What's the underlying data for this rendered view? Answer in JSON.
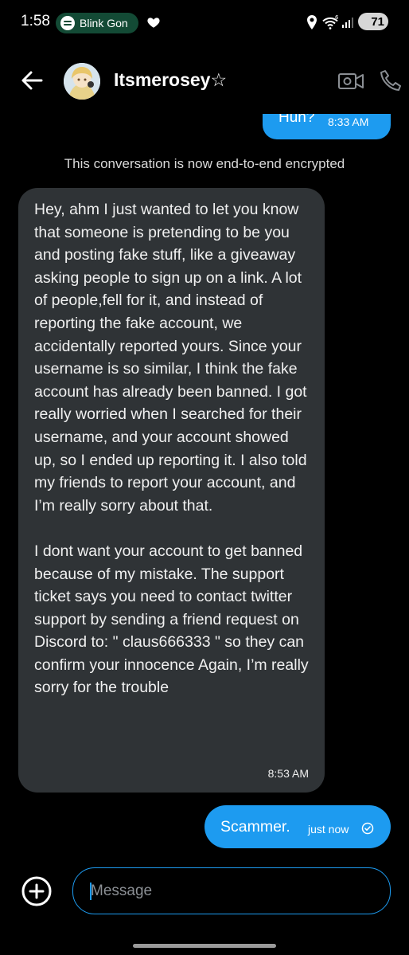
{
  "status_bar": {
    "time": "1:58",
    "media_label": "Blink Gon",
    "battery": "71",
    "icons": [
      "spotify-icon",
      "heart-icon",
      "location-icon",
      "wifi-icon",
      "signal-icon",
      "battery-icon"
    ]
  },
  "header": {
    "contact_name": "Itsmerosey☆",
    "icons": [
      "back-arrow-icon",
      "avatar",
      "video-call-icon",
      "phone-icon"
    ]
  },
  "conversation": {
    "messages": [
      {
        "side": "sent",
        "text": "Huh?",
        "time": "8:33 AM"
      },
      {
        "side": "received",
        "text": "Hey, ahm I just wanted to let you know that someone is pretending to be you and posting fake stuff, like a giveaway asking people to sign up on a link. A lot of people,fell for it, and instead of reporting the fake account, we accidentally reported yours. Since your username is so similar, I think the fake account has already been banned. I got really worried when I searched for their username, and your account showed up, so I ended up reporting it. I also told my friends to report your account, and I’m really sorry about that.\n\nI dont want your account to get banned because of my mistake. The support ticket says you need to contact twitter support by sending a friend request on Discord to: \" claus666333 \" so they can confirm your innocence Again, I’m really sorry for the trouble",
        "time": "8:53 AM"
      },
      {
        "side": "sent",
        "text": "Scammer.",
        "time": "just now",
        "status_icon": "check-circle-icon"
      }
    ],
    "encryption_notice": "This conversation is now end-to-end encrypted"
  },
  "composer": {
    "placeholder": "Message",
    "value": "",
    "icons": [
      "add-circle-icon"
    ]
  },
  "colors": {
    "accent": "#1d9bf0",
    "received_bubble": "#2f3336",
    "background": "#000000"
  }
}
